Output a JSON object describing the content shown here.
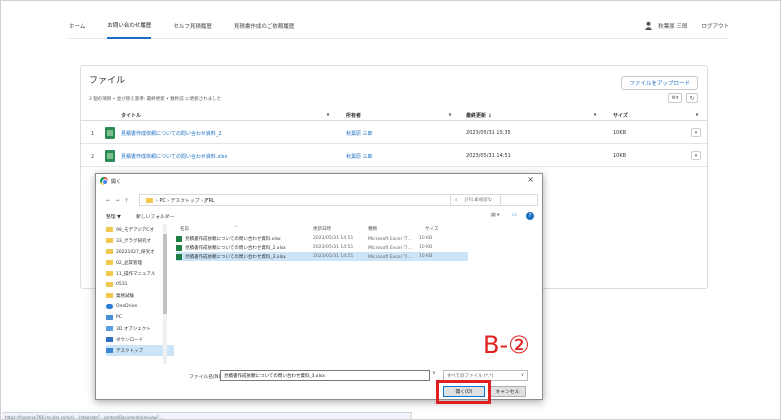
{
  "topnav": {
    "tabs": [
      "ホーム",
      "お問い合わせ履歴",
      "セルフ見積履歴",
      "見積書作成のご依頼履歴"
    ],
    "user_name": "秋葉原 三郎",
    "logout": "ログアウト"
  },
  "files": {
    "title": "ファイル",
    "upload_button": "ファイルをアップロード",
    "meta": "2 個の項目 • 並び替え基準: 最終更新 • 数秒前 に更新されました",
    "columns": [
      "タイトル",
      "所有者",
      "最終更新 ↓",
      "サイズ"
    ],
    "rows": [
      {
        "num": "1",
        "title": "見積書作成依頼についての問い合わせ資料_2",
        "owner": "秋葉原 三郎",
        "modified": "2023/05/31 15:35",
        "size": "10KB"
      },
      {
        "num": "2",
        "title": "見積書作成依頼についての問い合わせ資料.xlsx",
        "owner": "秋葉原 三郎",
        "modified": "2023/05/31 14:51",
        "size": "10KB"
      }
    ]
  },
  "dialog": {
    "title": "開く",
    "path": "›  PC  ›  デスクトップ  ›  JFRL",
    "search_placeholder": "JFRLの検索",
    "organize": "整理 ▼",
    "new_folder": "新しいフォルダー",
    "tree": [
      "99_モデアジアCオ",
      "33_グラグ研究オ",
      "20221027_研究オ",
      "02_品質管理",
      "11_操作マニュアル",
      "0531",
      "業務試験",
      "OneDrive",
      "PC",
      "3D オブジェクト",
      "ダウンロード",
      "デスクトップ"
    ],
    "columns": [
      "名前",
      "更新日時",
      "種類",
      "サイズ"
    ],
    "files": [
      {
        "name": "見積書作成依頼についての問い合わせ資料.xlsx",
        "date": "2023/05/31 14:51",
        "type": "Microsoft Excel ワ...",
        "size": "10 KB"
      },
      {
        "name": "見積書作成依頼についての問い合わせ資料_2.xlsx",
        "date": "2023/05/31 14:51",
        "type": "Microsoft Excel ワ...",
        "size": "10 KB"
      },
      {
        "name": "見積書作成依頼についての問い合わせ資料_3.xlsx",
        "date": "2023/05/31 14:51",
        "type": "Microsoft Excel ワ...",
        "size": "10 KB"
      }
    ],
    "filename_label": "ファイル名(N):",
    "filename_value": "見積書作成依頼についての問い合わせ資料_3.xlsx",
    "filetype": "すべてのファイル (*.*)",
    "open_button": "開く(O)",
    "cancel_button": "キャンセル"
  },
  "annotation": {
    "label": "B-②",
    "color": "#e02020"
  },
  "status_url": "https://fcoomsn766.my.site.com/s/...-Integrate?...contentDocument/preview?..."
}
